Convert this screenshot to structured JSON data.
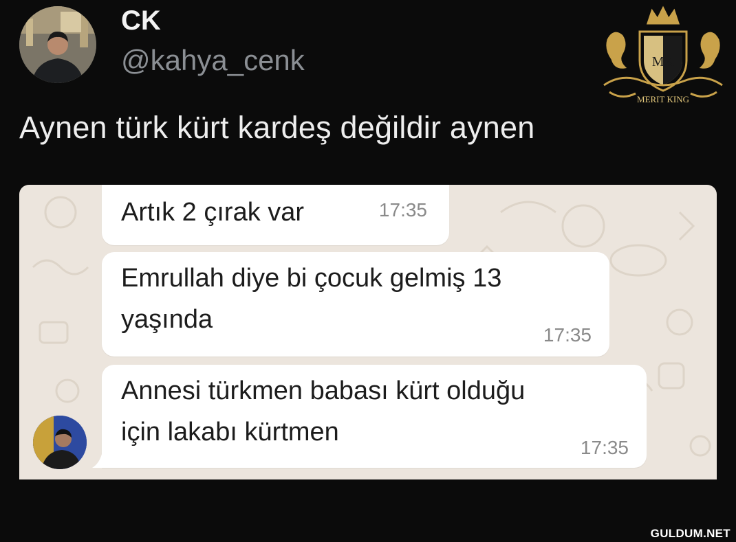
{
  "tweet": {
    "display_name": "CK",
    "handle": "@kahya_cenk",
    "text": "Aynen türk kürt kardeş değildir aynen"
  },
  "logo": {
    "monogram": "MK",
    "brand": "MERIT KING"
  },
  "chat": {
    "messages": [
      {
        "text_lines": [
          "Artık 2 çırak var"
        ],
        "time": "17:35"
      },
      {
        "text_lines": [
          "Emrullah diye bi çocuk gelmiş 13",
          "yaşında"
        ],
        "time": "17:35"
      },
      {
        "text_lines": [
          "Annesi türkmen babası kürt olduğu",
          "için lakabı kürtmen"
        ],
        "time": "17:35"
      }
    ]
  },
  "watermark": "GULDUM.NET",
  "colors": {
    "background": "#0b0b0b",
    "chat_background": "#ece5dd",
    "bubble": "#ffffff",
    "gold": "#c9a24a"
  }
}
